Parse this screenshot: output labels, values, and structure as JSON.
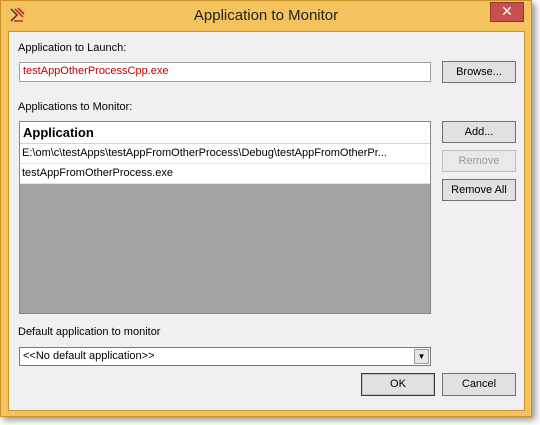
{
  "window": {
    "title": "Application to Monitor",
    "close_glyph": "✕"
  },
  "launch": {
    "label": "Application to Launch:",
    "value": "testAppOtherProcessCpp.exe",
    "browse_label": "Browse..."
  },
  "monitor": {
    "label": "Applications to Monitor:",
    "column_header": "Application",
    "rows": [
      "E:\\om\\c\\testApps\\testAppFromOtherProcess\\Debug\\testAppFromOtherPr...",
      "testAppFromOtherProcess.exe"
    ],
    "add_label": "Add...",
    "remove_label": "Remove",
    "remove_all_label": "Remove All"
  },
  "default_app": {
    "label": "Default application to monitor",
    "selected": "<<No default application>>"
  },
  "footer": {
    "ok_label": "OK",
    "cancel_label": "Cancel"
  },
  "colors": {
    "frame": "#f5c35d",
    "launch_text": "#c00000"
  }
}
